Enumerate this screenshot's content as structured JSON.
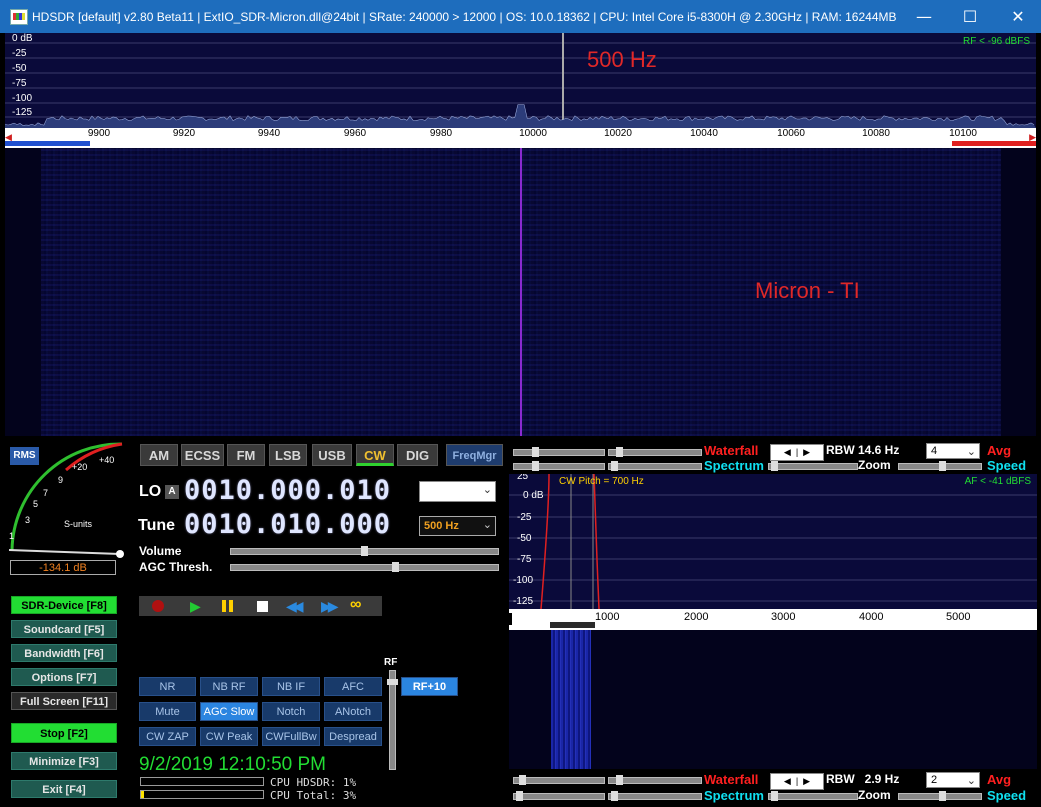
{
  "window": {
    "title": "HDSDR  [default]  v2.80 Beta11  |  ExtIO_SDR-Micron.dll@24bit  |  SRate: 240000 > 12000  |  OS: 10.0.18362  |  CPU: Intel Core i5-8300H @ 2.30GHz  |  RAM: 16244MB",
    "minimize": "—",
    "maximize": "☐",
    "close": "✕"
  },
  "rf_spectrum": {
    "db_labels": [
      "0 dB",
      "-25",
      "-50",
      "-75",
      "-100",
      "-125"
    ],
    "rf_level": "RF < -96 dBFS",
    "annotation": "500 Hz"
  },
  "freq_scale": [
    "9900",
    "9920",
    "9940",
    "9960",
    "9980",
    "10000",
    "10020",
    "10040",
    "10060",
    "10080",
    "10100"
  ],
  "waterfall": {
    "annotation": "Micron - TI"
  },
  "smeter": {
    "rms_label": "RMS",
    "scale_labels": [
      "1",
      "3",
      "5",
      "7",
      "9",
      "+20",
      "+40"
    ],
    "units_label": "S-units",
    "reading": "-134.1 dB"
  },
  "left_buttons": [
    {
      "label": "SDR-Device [F8]"
    },
    {
      "label": "Soundcard  [F5]"
    },
    {
      "label": "Bandwidth  [F6]"
    },
    {
      "label": "Options    [F7]"
    },
    {
      "label": "Full Screen [F11]"
    },
    {
      "label": "Stop        [F2]"
    },
    {
      "label": "Minimize  [F3]"
    },
    {
      "label": "Exit        [F4]"
    }
  ],
  "modes": [
    "AM",
    "ECSS",
    "FM",
    "LSB",
    "USB",
    "CW",
    "DIG"
  ],
  "selected_mode": "CW",
  "freqmgr": "FreqMgr",
  "lo": {
    "label": "LO",
    "badge": "A",
    "value": "0010.000.010"
  },
  "tune": {
    "label": "Tune",
    "value": "0010.010.000",
    "filter": "500 Hz"
  },
  "volume_label": "Volume",
  "volume_level": 0.5,
  "agc_label": "AGC Thresh.",
  "agc_level": 0.62,
  "transport_icons": [
    "record-icon",
    "play-icon",
    "pause-icon",
    "stop-icon",
    "rewind-icon",
    "fast-forward-icon",
    "loop-icon"
  ],
  "dsp_buttons": [
    "NR",
    "NB RF",
    "NB IF",
    "AFC",
    "Mute",
    "AGC Slow",
    "Notch",
    "ANotch",
    "CW ZAP",
    "CW Peak",
    "CWFullBw",
    "Despread"
  ],
  "rf_label": "RF",
  "rf_button": "RF+10",
  "datetime": "9/2/2019 12:10:50 PM",
  "cpu": {
    "hdsdr": "CPU HDSDR:  1%",
    "total": "CPU Total:  3%"
  },
  "top_right": {
    "waterfall": "Waterfall",
    "spectrum": "Spectrum",
    "rbw": "RBW 14.6 Hz",
    "avg_value": "4",
    "avg": "Avg",
    "zoom": "Zoom",
    "speed": "Speed"
  },
  "af_spectrum": {
    "db_labels": [
      "25",
      "0 dB",
      "-25",
      "-50",
      "-75",
      "-100",
      "-125"
    ],
    "cw_pitch": "CW Pitch = 700 Hz",
    "af_level": "AF < -41 dBFS",
    "scale": [
      "1000",
      "2000",
      "3000",
      "4000",
      "5000"
    ]
  },
  "bottom_right": {
    "waterfall": "Waterfall",
    "spectrum": "Spectrum",
    "rbw": "RBW   2.9 Hz",
    "avg_value": "2",
    "avg": "Avg",
    "zoom": "Zoom",
    "speed": "Speed"
  }
}
